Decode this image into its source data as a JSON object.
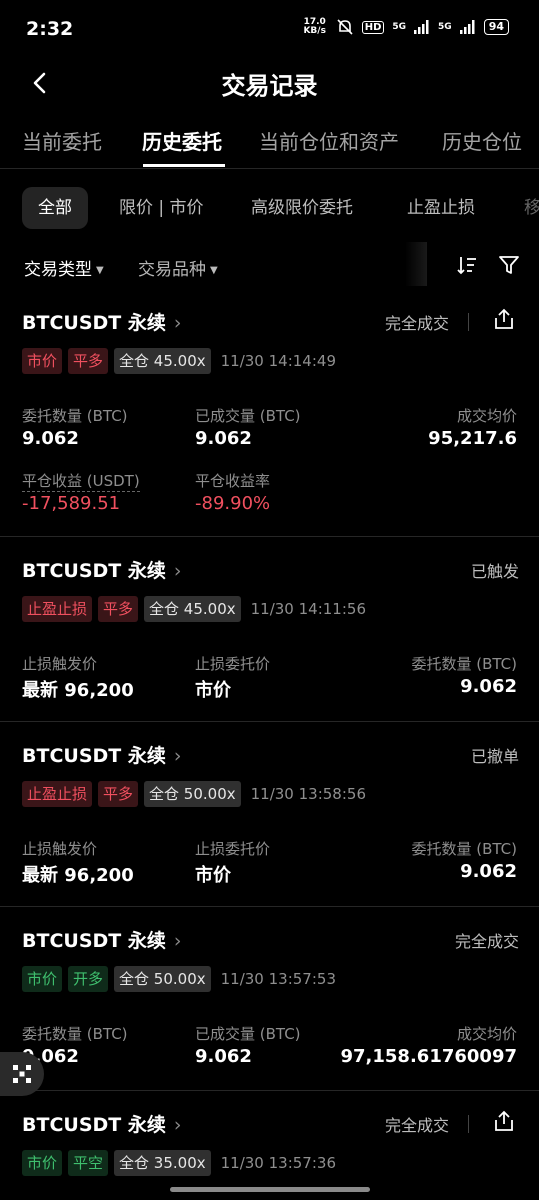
{
  "status_bar": {
    "time": "2:32",
    "net_speed": "17.0 KB/s",
    "hd": "HD",
    "sig1": "5G",
    "sig2": "5G",
    "battery": "94"
  },
  "header": {
    "title": "交易记录"
  },
  "tabs": [
    "当前委托",
    "历史委托",
    "当前仓位和资产",
    "历史仓位"
  ],
  "chips": [
    "全部",
    "限价 | 市价",
    "高级限价委托",
    "止盈止损",
    "移"
  ],
  "filters": {
    "type": "交易类型",
    "symbol": "交易品种"
  },
  "cards": [
    {
      "symbol": "BTCUSDT 永续",
      "status": "完全成交",
      "tags": [
        "市价",
        "平多",
        "全仓 45.00x"
      ],
      "timestamp": "11/30 14:14:49",
      "l1": "委托数量 (BTC)",
      "v1": "9.062",
      "l2": "已成交量 (BTC)",
      "v2": "9.062",
      "l3": "成交均价",
      "v3": "95,217.6",
      "l4": "平仓收益 (USDT)",
      "v4": "-17,589.51",
      "l5": "平仓收益率",
      "v5": "-89.90%"
    },
    {
      "symbol": "BTCUSDT 永续",
      "status": "已触发",
      "tags": [
        "止盈止损",
        "平多",
        "全仓 45.00x"
      ],
      "timestamp": "11/30 14:11:56",
      "l1": "止损触发价",
      "v1": "最新 96,200",
      "l2": "止损委托价",
      "v2": "市价",
      "l3": "委托数量 (BTC)",
      "v3": "9.062"
    },
    {
      "symbol": "BTCUSDT 永续",
      "status": "已撤单",
      "tags": [
        "止盈止损",
        "平多",
        "全仓 50.00x"
      ],
      "timestamp": "11/30 13:58:56",
      "l1": "止损触发价",
      "v1": "最新 96,200",
      "l2": "止损委托价",
      "v2": "市价",
      "l3": "委托数量 (BTC)",
      "v3": "9.062"
    },
    {
      "symbol": "BTCUSDT 永续",
      "status": "完全成交",
      "tags": [
        "市价",
        "开多",
        "全仓 50.00x"
      ],
      "timestamp": "11/30 13:57:53",
      "l1": "委托数量 (BTC)",
      "v1": "9.062",
      "l2": "已成交量 (BTC)",
      "v2": "9.062",
      "l3": "成交均价",
      "v3": "97,158.61760097"
    },
    {
      "symbol": "BTCUSDT 永续",
      "status": "完全成交",
      "tags": [
        "市价",
        "平空",
        "全仓 35.00x"
      ],
      "timestamp": "11/30 13:57:36"
    }
  ],
  "colors": {
    "loss": "#f0505f",
    "gain": "#3fbf6e",
    "bg": "#000000"
  }
}
